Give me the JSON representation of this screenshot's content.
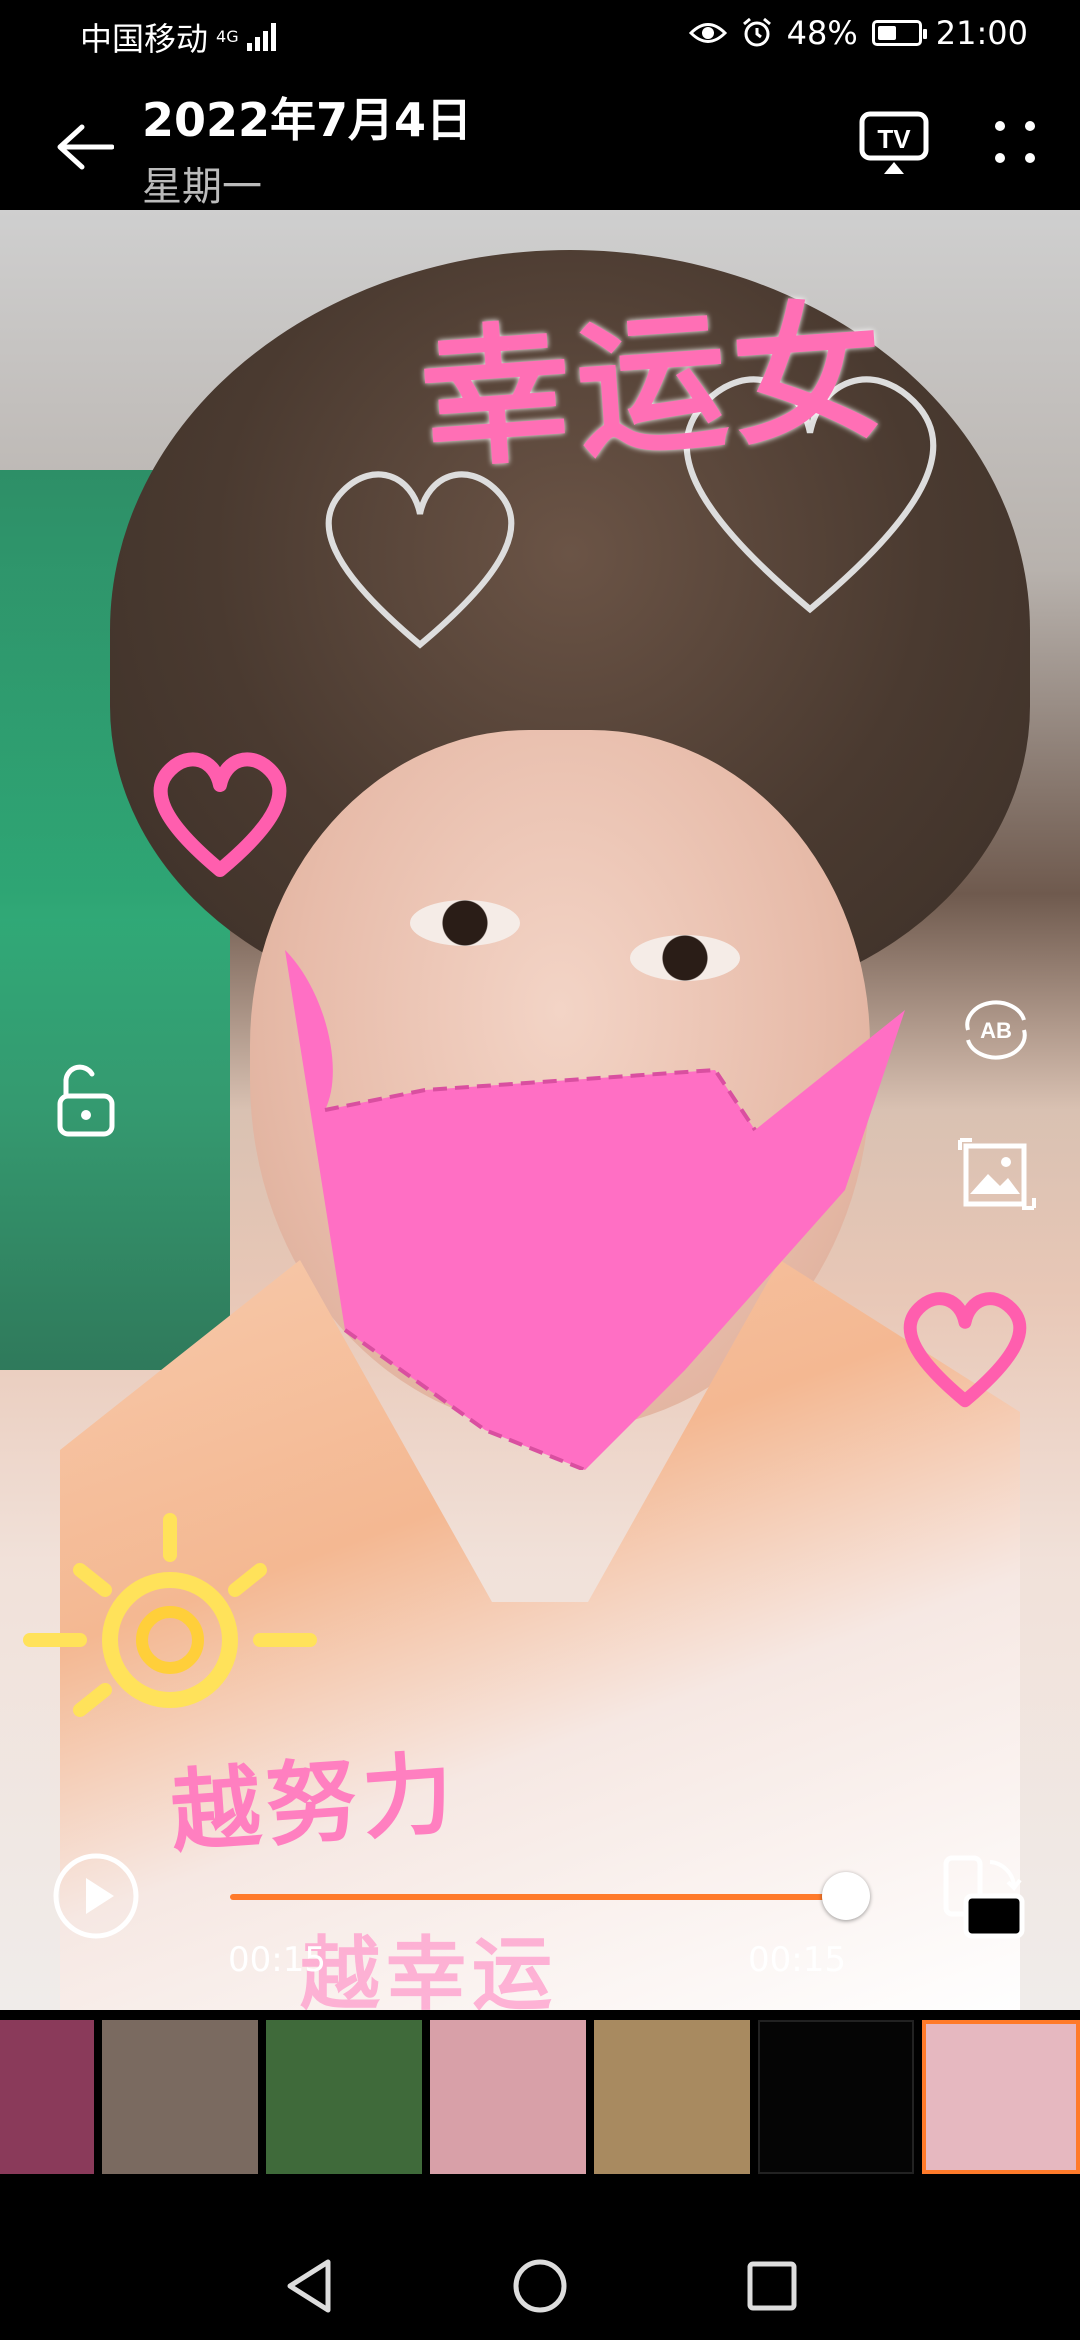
{
  "status_bar": {
    "carrier": "中国移动",
    "network_type": "4G",
    "battery_percent": "48%",
    "battery_level": 0.48,
    "time": "21:00",
    "icons": [
      "eye-comfort-icon",
      "alarm-icon",
      "battery-saver-icon"
    ]
  },
  "header": {
    "date": "2022年7月4日",
    "weekday": "星期一",
    "tv_label": "TV"
  },
  "photo": {
    "sticker_top": "幸运女",
    "sticker_bottom": "越努力",
    "sticker_bottom2": "越幸运"
  },
  "player": {
    "current_time": "00:15",
    "total_time": "00:15",
    "progress": 1.0
  },
  "thumbnails": [
    {
      "name": "thumb-1",
      "color": "#8a3a5a"
    },
    {
      "name": "thumb-2",
      "color": "#7a6a60"
    },
    {
      "name": "thumb-3",
      "color": "#3f6a3a"
    },
    {
      "name": "thumb-4",
      "color": "#d8a0a8"
    },
    {
      "name": "thumb-5",
      "color": "#a88a60"
    },
    {
      "name": "thumb-6",
      "color": "#050505"
    },
    {
      "name": "thumb-7",
      "color": "#e6b8c0",
      "selected": true
    }
  ],
  "accent_color": "#ff7a2a"
}
